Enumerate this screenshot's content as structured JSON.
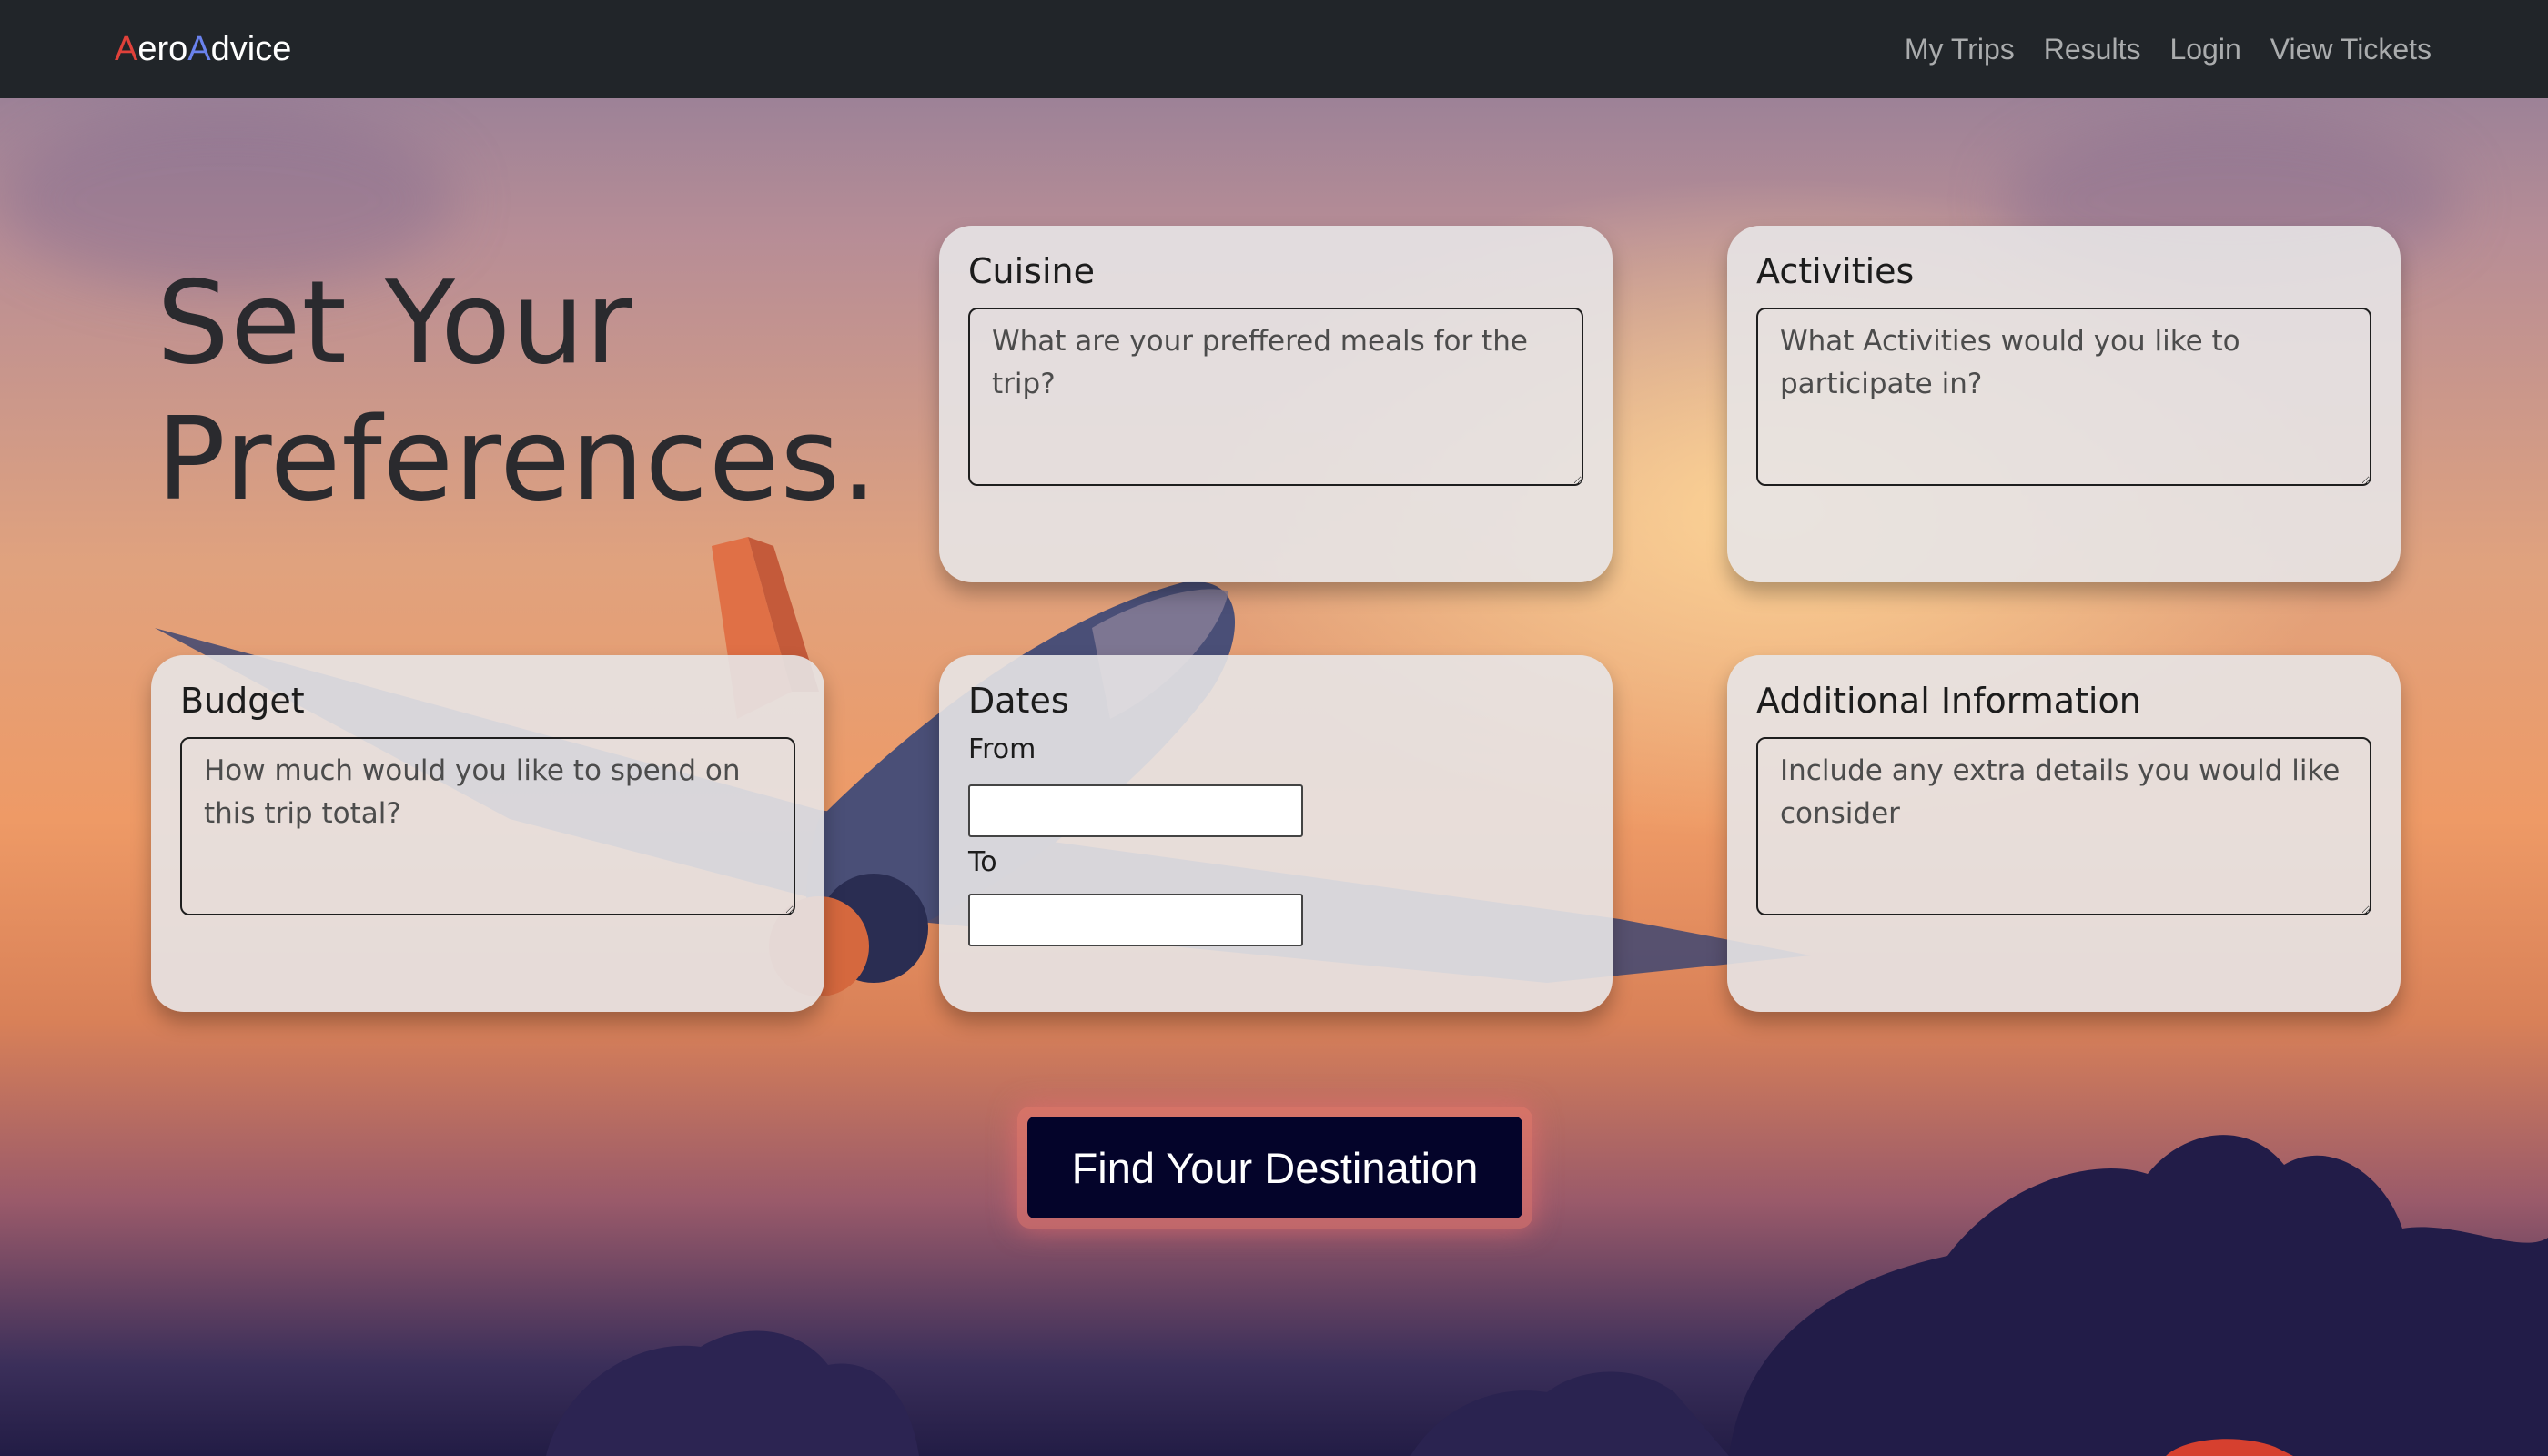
{
  "navbar": {
    "brand_a1": "A",
    "brand_ero": "ero",
    "brand_a2": "A",
    "brand_dvice": "dvice",
    "links": [
      "My Trips",
      "Results",
      "Login",
      "View Tickets"
    ]
  },
  "hero": {
    "line1": "Set Your",
    "line2": "Preferences."
  },
  "cards": {
    "cuisine": {
      "title": "Cuisine",
      "placeholder": "What are your preffered meals for the trip?"
    },
    "activities": {
      "title": "Activities",
      "placeholder": "What Activities would you like to participate in?"
    },
    "budget": {
      "title": "Budget",
      "placeholder": "How much would you like to spend on this trip total?"
    },
    "dates": {
      "title": "Dates",
      "from_label": "From",
      "from_value": "",
      "to_label": "To",
      "to_value": ""
    },
    "additional": {
      "title": "Additional Information",
      "placeholder": "Include any extra details you would like consider"
    }
  },
  "cta": {
    "label": "Find Your Destination"
  },
  "colors": {
    "navbar_bg": "#212529",
    "brand_a1": "#e0413a",
    "brand_a2": "#6a82ee",
    "cta_bg": "#04042a",
    "card_bg": "#e7e4e5"
  }
}
